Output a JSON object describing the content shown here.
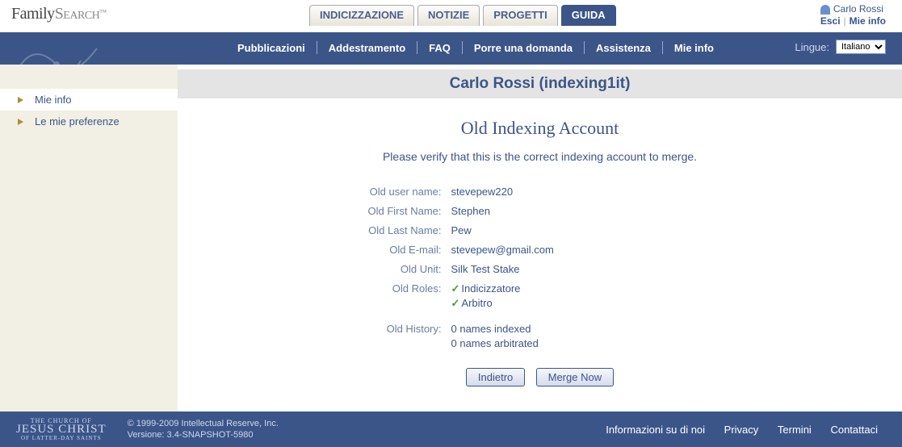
{
  "logo": {
    "part1": "Family",
    "part2": "Search"
  },
  "user": {
    "name": "Carlo Rossi",
    "logout": "Esci",
    "myinfo": "Mie info"
  },
  "maintabs": [
    {
      "label": "INDICIZZAZIONE",
      "active": false
    },
    {
      "label": "NOTIZIE",
      "active": false
    },
    {
      "label": "PROGETTI",
      "active": false
    },
    {
      "label": "GUIDA",
      "active": true
    }
  ],
  "navlinks": [
    "Pubblicazioni",
    "Addestramento",
    "FAQ",
    "Porre una domanda",
    "Assistenza",
    "Mie info"
  ],
  "language": {
    "label": "Lingue:",
    "selected": "Italiano",
    "options": [
      "Italiano"
    ]
  },
  "sidebar": [
    {
      "label": "Mie info",
      "active": true
    },
    {
      "label": "Le mie preferenze",
      "active": false
    }
  ],
  "page": {
    "title": "Carlo Rossi (indexing1it)",
    "subtitle": "Old Indexing Account",
    "instruction": "Please verify that this is the correct indexing account to merge.",
    "fields": {
      "oldUserName": {
        "label": "Old user name:",
        "value": "stevepew220"
      },
      "oldFirstName": {
        "label": "Old First Name:",
        "value": "Stephen"
      },
      "oldLastName": {
        "label": "Old Last Name:",
        "value": "Pew"
      },
      "oldEmail": {
        "label": "Old E-mail:",
        "value": "stevepew@gmail.com"
      },
      "oldUnit": {
        "label": "Old Unit:",
        "value": "Silk Test Stake"
      },
      "oldRoles": {
        "label": "Old Roles:",
        "values": [
          "Indicizzatore",
          "Arbitro"
        ]
      },
      "oldHistory": {
        "label": "Old History:",
        "values": [
          "0 names indexed",
          "0 names arbitrated"
        ]
      }
    },
    "buttons": {
      "back": "Indietro",
      "merge": "Merge Now"
    }
  },
  "footer": {
    "church": [
      "THE CHURCH OF",
      "JESUS CHRIST",
      "OF LATTER-DAY SAINTS"
    ],
    "copyright": "© 1999-2009  Intellectual Reserve, Inc.",
    "version": "Versione: 3.4-SNAPSHOT-5980",
    "links": [
      "Informazioni su di noi",
      "Privacy",
      "Termini",
      "Contattaci"
    ]
  }
}
